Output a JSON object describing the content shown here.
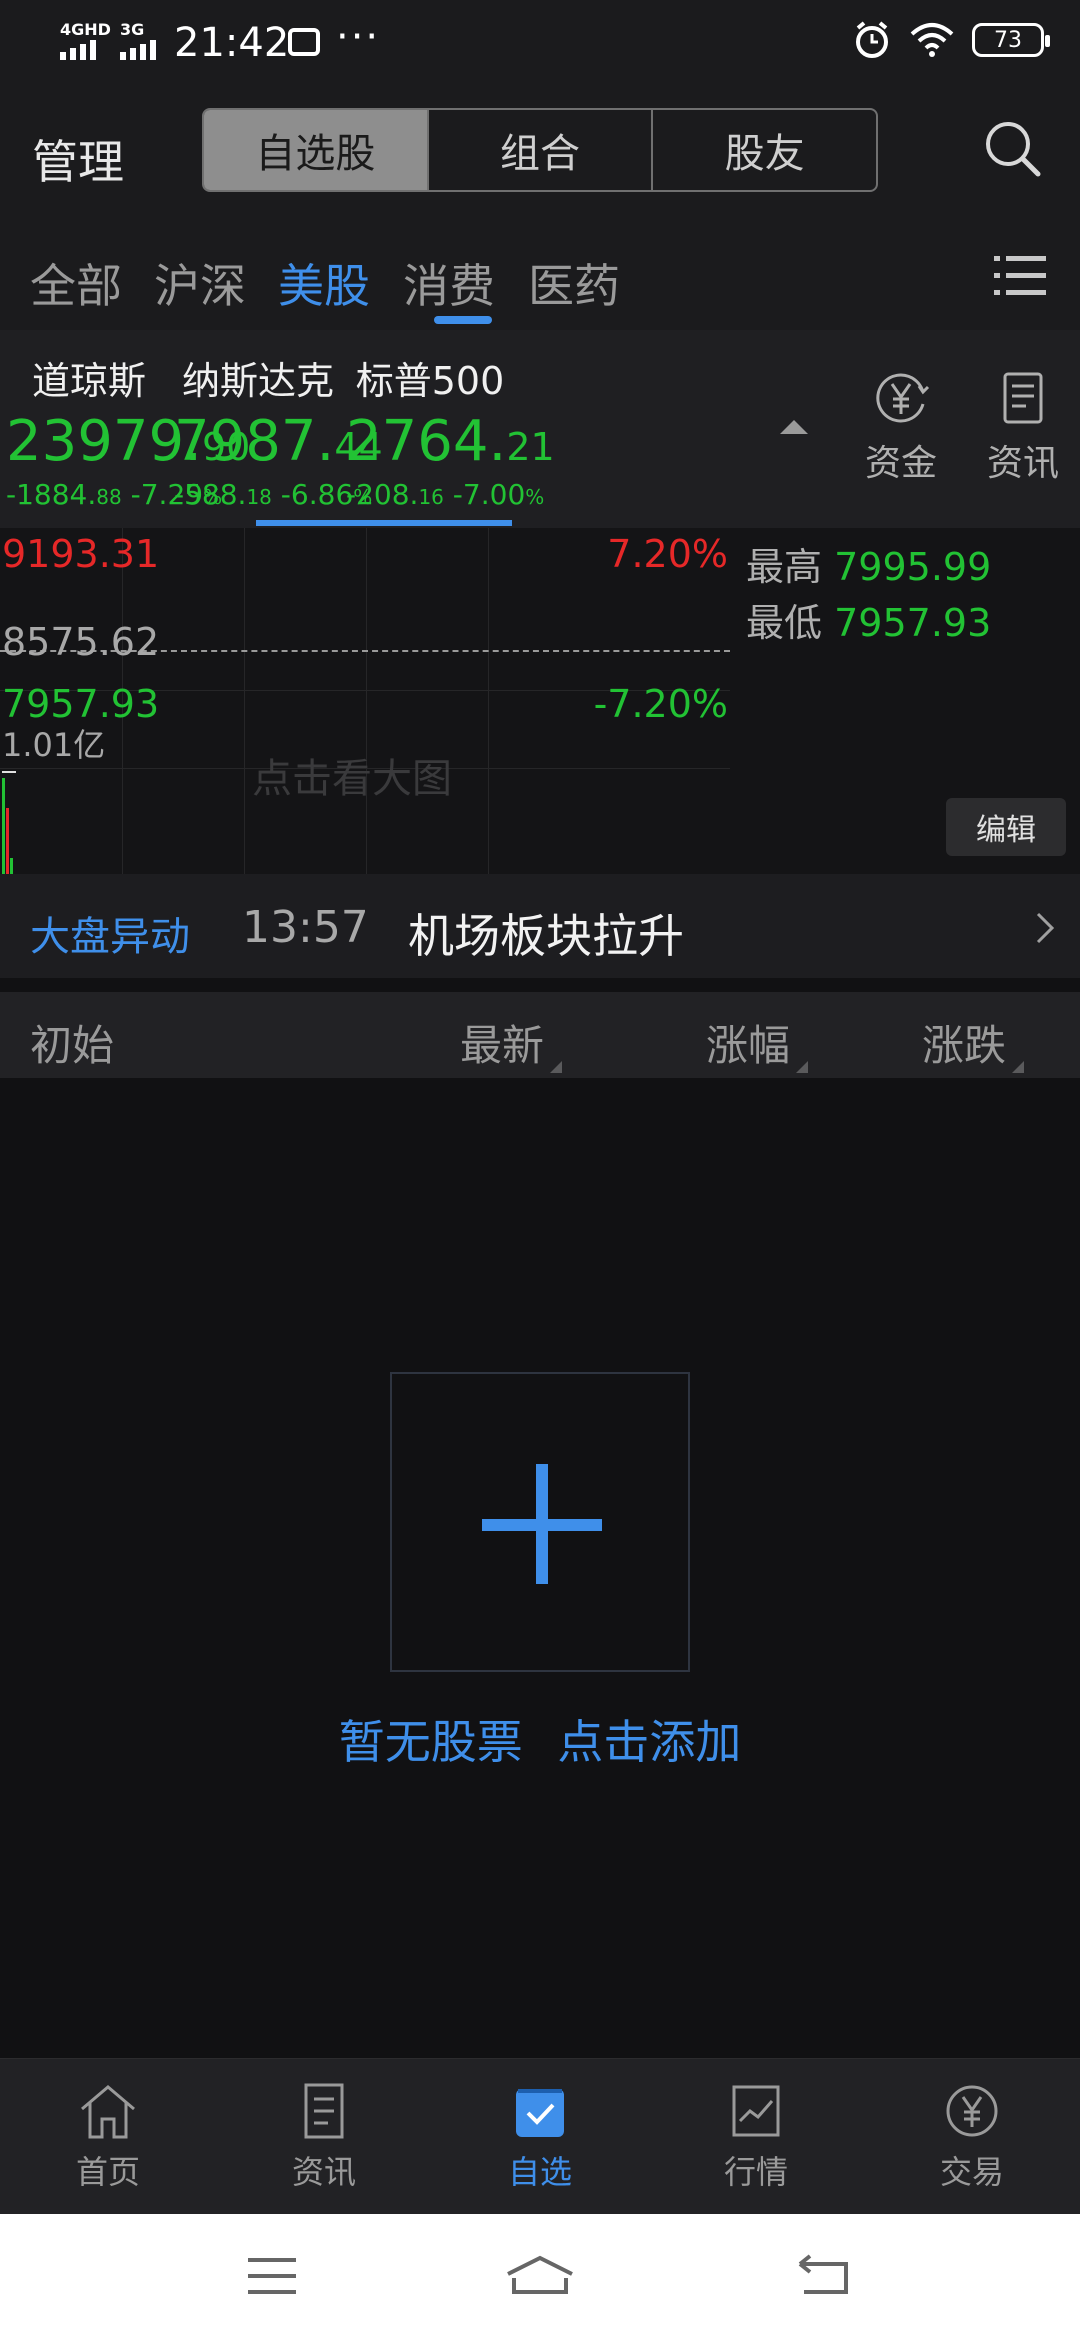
{
  "status_bar": {
    "network_1": "4GHD",
    "network_2": "3G",
    "time": "21:42",
    "dots": "···",
    "battery": "73"
  },
  "header": {
    "manage": "管理",
    "segments": [
      "自选股",
      "组合",
      "股友"
    ],
    "active_segment": 0
  },
  "categories": {
    "items": [
      "全部",
      "沪深",
      "美股",
      "消费",
      "医药"
    ],
    "active": 2
  },
  "indices": [
    {
      "name": "道琼斯",
      "price_int": "23979.",
      "price_dec": "90",
      "chg_main": "-1884.",
      "chg_small": "88",
      "pct_main": " -7.29",
      "pct_small": "%"
    },
    {
      "name": "纳斯达克",
      "price_int": "7987.",
      "price_dec": "44",
      "chg_main": "-588.",
      "chg_small": "18",
      "pct_main": " -6.86",
      "pct_small": "%"
    },
    {
      "name": "标普500",
      "price_int": "2764.",
      "price_dec": "21",
      "chg_main": "-208.",
      "chg_small": "16",
      "pct_main": " -7.00",
      "pct_small": "%"
    }
  ],
  "side_buttons": {
    "funds": "资金",
    "news": "资讯"
  },
  "chart": {
    "top_price": "9193.31",
    "top_pct": "7.20%",
    "mid_price": "8575.62",
    "bottom_price": "7957.93",
    "bottom_pct": "-7.20%",
    "volume": "1.01亿",
    "hint": "点击看大图",
    "high_label": "最高",
    "high_value": "7995.99",
    "low_label": "最低",
    "low_value": "7957.93",
    "edit": "编辑"
  },
  "alert": {
    "tag": "大盘异动",
    "time": "13:57",
    "text": "机场板块拉升"
  },
  "list_header": {
    "initial": "初始",
    "latest": "最新",
    "change_pct": "涨幅",
    "change": "涨跌"
  },
  "empty_state": {
    "no_stocks": "暂无股票",
    "add": "点击添加"
  },
  "bottom_nav": {
    "items": [
      "首页",
      "资讯",
      "自选",
      "行情",
      "交易"
    ],
    "active": 2
  },
  "colors": {
    "accent": "#3f8fea",
    "down": "#22c234",
    "up": "#e62828",
    "background": "#111113"
  }
}
